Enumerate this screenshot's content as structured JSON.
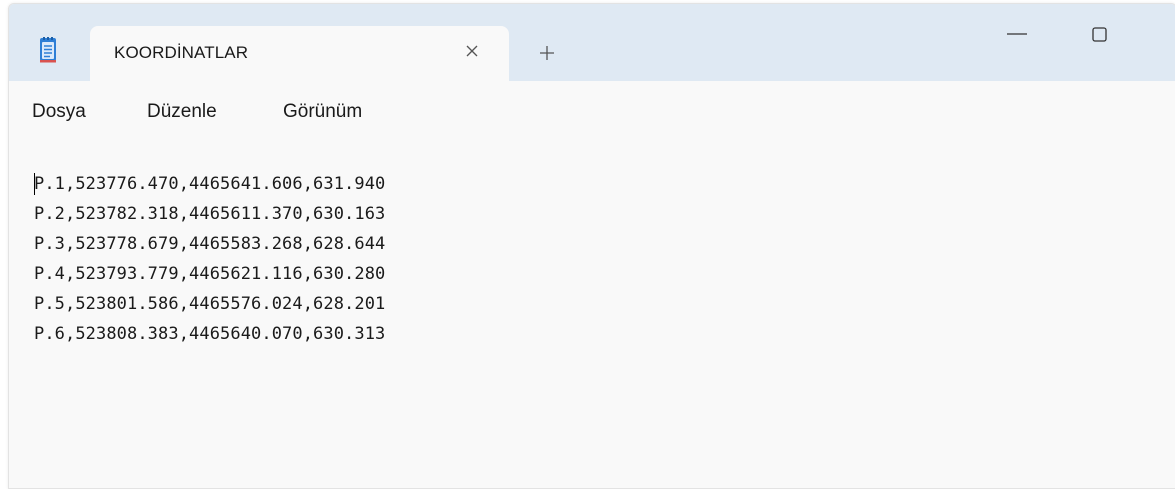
{
  "window": {
    "tab_title": "KOORDİNATLAR",
    "new_tab_symbol": "+",
    "close_symbol": "×"
  },
  "menu": {
    "items": [
      "Dosya",
      "Düzenle",
      "Görünüm"
    ]
  },
  "editor": {
    "lines": [
      "P.1,523776.470,4465641.606,631.940",
      "P.2,523782.318,4465611.370,630.163",
      "P.3,523778.679,4465583.268,628.644",
      "P.4,523793.779,4465621.116,630.280",
      "P.5,523801.586,4465576.024,628.201",
      "P.6,523808.383,4465640.070,630.313"
    ]
  },
  "icons": {
    "app": "notepad-icon",
    "tab_close": "close-icon",
    "new_tab": "plus-icon",
    "minimize": "minimize-icon",
    "maximize": "maximize-icon"
  },
  "colors": {
    "titlebar": "#dfe9f3",
    "window": "#f9f9f9",
    "text": "#1a1a1a",
    "app_icon_accent": "#2e7fd6"
  }
}
